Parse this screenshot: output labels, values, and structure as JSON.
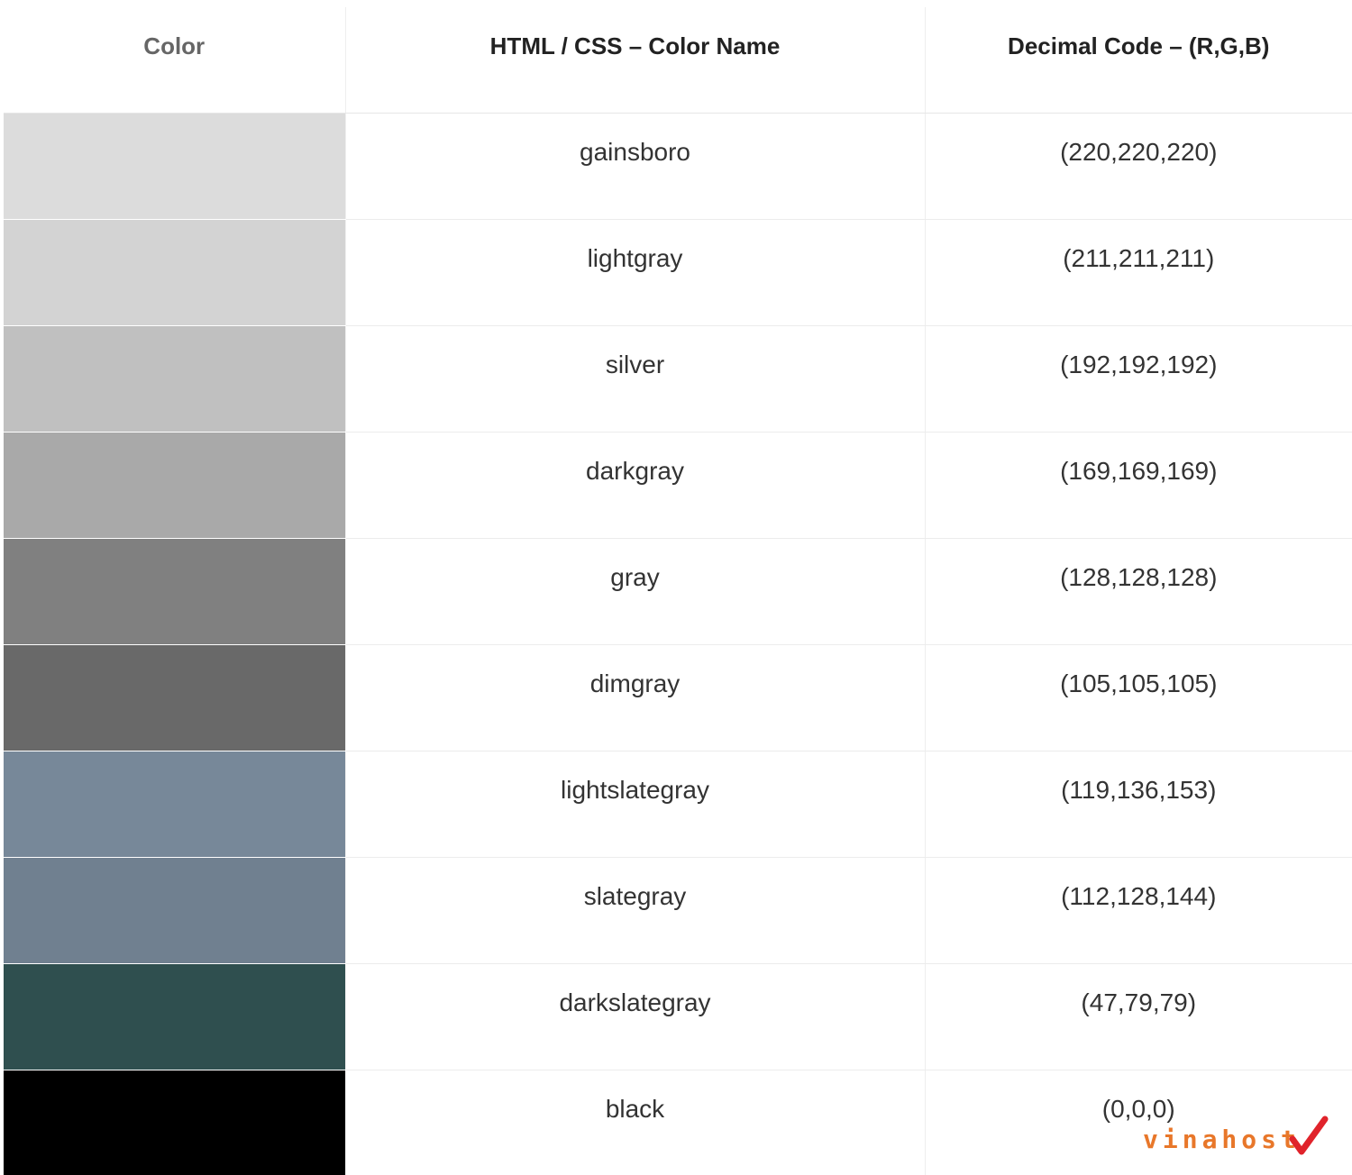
{
  "table": {
    "headers": {
      "color": "Color",
      "name": "HTML / CSS – Color Name",
      "decimal": "Decimal Code – (R,G,B)"
    },
    "rows": [
      {
        "swatch": "#dcdcdc",
        "name": "gainsboro",
        "rgb": "(220,220,220)"
      },
      {
        "swatch": "#d3d3d3",
        "name": "lightgray",
        "rgb": "(211,211,211)"
      },
      {
        "swatch": "#c0c0c0",
        "name": "silver",
        "rgb": "(192,192,192)"
      },
      {
        "swatch": "#a9a9a9",
        "name": "darkgray",
        "rgb": "(169,169,169)"
      },
      {
        "swatch": "#808080",
        "name": "gray",
        "rgb": "(128,128,128)"
      },
      {
        "swatch": "#696969",
        "name": "dimgray",
        "rgb": "(105,105,105)"
      },
      {
        "swatch": "#778899",
        "name": "lightslategray",
        "rgb": "(119,136,153)"
      },
      {
        "swatch": "#708090",
        "name": "slategray",
        "rgb": "(112,128,144)"
      },
      {
        "swatch": "#2f4f4f",
        "name": "darkslategray",
        "rgb": "(47,79,79)"
      },
      {
        "swatch": "#000000",
        "name": "black",
        "rgb": "(0,0,0)"
      }
    ]
  },
  "watermark": {
    "text": "vinahost",
    "text_color": "#e8772a",
    "check_color": "#e0232b",
    "icon": "checkmark-icon"
  }
}
